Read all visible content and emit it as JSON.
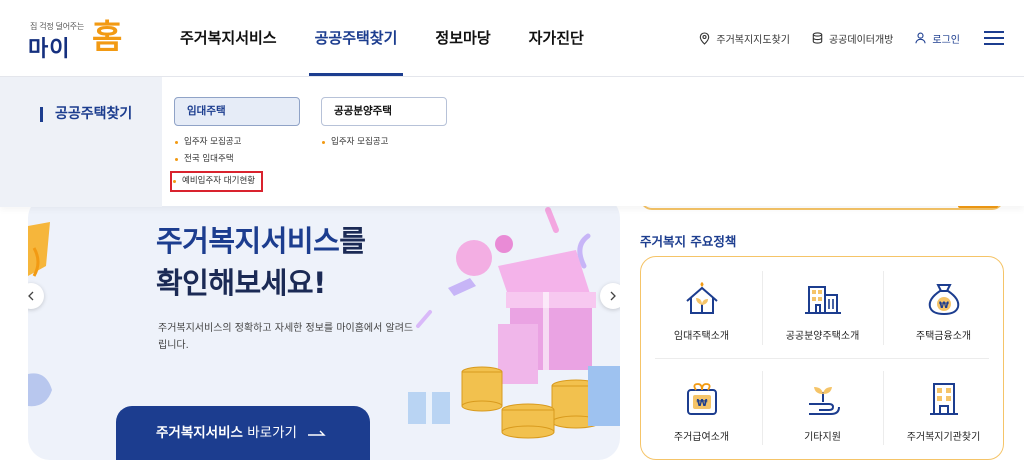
{
  "logo": {
    "tagline": "집 걱정 덜어주는",
    "name": "마이",
    "name_accent": "홈"
  },
  "gnb": [
    {
      "label": "주거복지서비스",
      "active": false
    },
    {
      "label": "공공주택찾기",
      "active": true
    },
    {
      "label": "정보마당",
      "active": false
    },
    {
      "label": "자가진단",
      "active": false
    }
  ],
  "util": {
    "map_label": "주거복지지도찾기",
    "opendata_label": "공공데이터개방",
    "login_label": "로그인"
  },
  "dropdown": {
    "side_title": "공공주택찾기",
    "columns": [
      {
        "title": "임대주택",
        "active": true,
        "items": [
          "입주자 모집공고",
          "전국 임대주택",
          "예비입주자 대기현황"
        ]
      },
      {
        "title": "공공분양주택",
        "active": false,
        "items": [
          "입주자 모집공고"
        ]
      }
    ],
    "highlighted_item": "예비입주자 대기현황"
  },
  "hero": {
    "headline_1": "",
    "headline_2_accent": "주거복지서비스",
    "headline_2_rest": "를",
    "headline_3": "확인해보세요!",
    "description": "주거복지서비스의 정확하고 자세한 정보를 마이홈에서 알려드립니다.",
    "button_bold": "주거복지서비스",
    "button_rest": "바로가기"
  },
  "policy": {
    "title": "주거복지 주요정책",
    "items": [
      {
        "label": "임대주택소개",
        "icon": "house-sprout-icon"
      },
      {
        "label": "공공분양주택소개",
        "icon": "apartment-building-icon"
      },
      {
        "label": "주택금융소개",
        "icon": "money-bag-icon"
      },
      {
        "label": "주거급여소개",
        "icon": "won-gift-icon"
      },
      {
        "label": "기타지원",
        "icon": "sprout-hand-icon"
      },
      {
        "label": "주거복지기관찾기",
        "icon": "office-building-icon"
      }
    ]
  },
  "colors": {
    "primary": "#1c3d8f",
    "accent": "#f29a13",
    "highlight": "#d9232e",
    "panel": "#eef1f7"
  }
}
